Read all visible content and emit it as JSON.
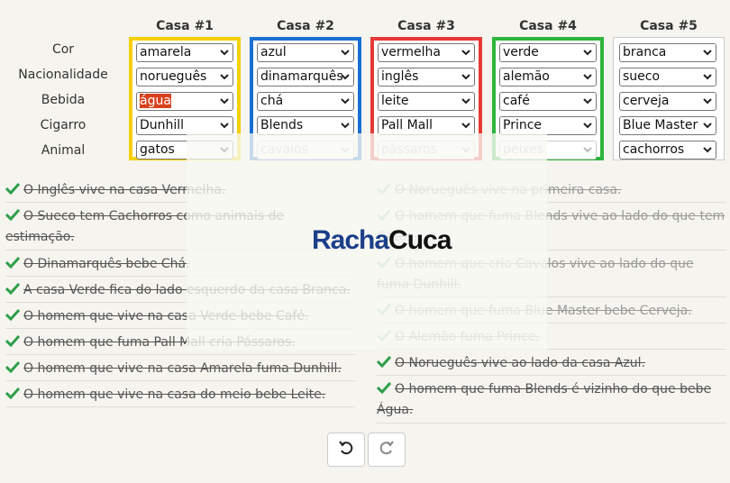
{
  "row_labels": [
    "Cor",
    "Nacionalidade",
    "Bebida",
    "Cigarro",
    "Animal"
  ],
  "houses": [
    {
      "title": "Casa #1",
      "color": "#f5d000",
      "values": [
        "amarela",
        "norueguês",
        "água",
        "Dunhill",
        "gatos"
      ]
    },
    {
      "title": "Casa #2",
      "color": "#1a6fd1",
      "values": [
        "azul",
        "dinamarquês",
        "chá",
        "Blends",
        "cavalos"
      ]
    },
    {
      "title": "Casa #3",
      "color": "#e53935",
      "values": [
        "vermelha",
        "inglês",
        "leite",
        "Pall Mall",
        "pássaros"
      ]
    },
    {
      "title": "Casa #4",
      "color": "#2db53c",
      "values": [
        "verde",
        "alemão",
        "café",
        "Prince",
        "peixes"
      ]
    },
    {
      "title": "Casa #5",
      "color": "#cccccc",
      "values": [
        "branca",
        "sueco",
        "cerveja",
        "Blue Master",
        "cachorros"
      ]
    }
  ],
  "clues_left": [
    "O Inglês vive na casa Vermelha.",
    "O Sueco tem Cachorros como animais de estimação.",
    "O Dinamarquês bebe Chá.",
    "A casa Verde fica do lado esquerdo da casa Branca.",
    "O homem que vive na casa Verde bebe Café.",
    "O homem que fuma Pall Mall cria Pássaros.",
    "O homem que vive na casa Amarela fuma Dunhill.",
    "O homem que vive na casa do meio bebe Leite."
  ],
  "clues_right": [
    "O Norueguês vive na primeira casa.",
    "O homem que fuma Blends vive ao lado do que tem Gatos.",
    "O homem que cria Cavalos vive ao lado do que fuma Dunhill.",
    "O homem que fuma Blue Master bebe Cerveja.",
    "O Alemão fuma Prince.",
    "O Norueguês vive ao lado da casa Azul.",
    "O homem que fuma Blends é vizinho do que bebe Água."
  ],
  "logo": {
    "part1": "Racha",
    "part2": "Cuca"
  },
  "check_color": "#2e9e4a",
  "controls": {
    "undo": "undo-icon",
    "redo": "redo-icon"
  }
}
